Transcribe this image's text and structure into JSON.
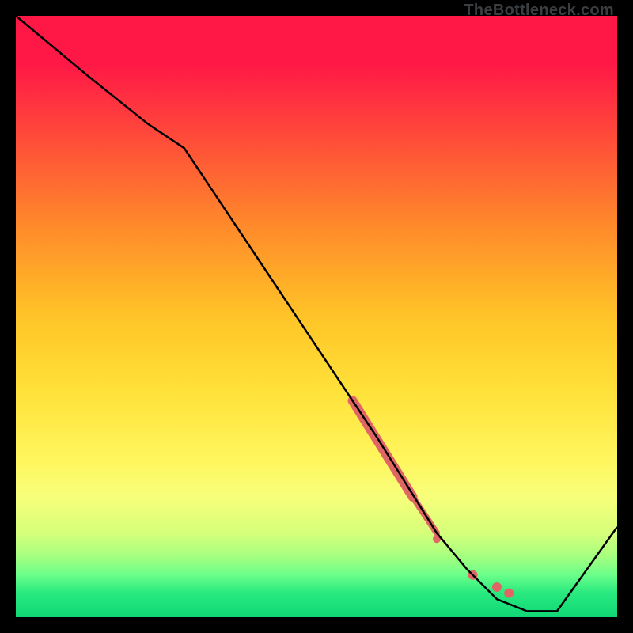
{
  "watermark": "TheBottleneck.com",
  "chart_data": {
    "type": "line",
    "xlim": [
      0,
      100
    ],
    "ylim": [
      0,
      100
    ],
    "title": "",
    "xlabel": "",
    "ylabel": "",
    "x": [
      0,
      12,
      22,
      28,
      40,
      50,
      60,
      65,
      70,
      75,
      80,
      85,
      90,
      100
    ],
    "values": [
      100,
      90,
      82,
      78,
      60,
      45,
      30,
      22,
      14,
      8,
      3,
      1,
      1,
      15
    ],
    "highlight_segments": [
      {
        "x0": 56,
        "y0": 36,
        "x1": 66,
        "y1": 20,
        "width": 12
      },
      {
        "x0": 66,
        "y0": 20,
        "x1": 70,
        "y1": 14,
        "width": 8
      }
    ],
    "highlight_points": [
      {
        "x": 70,
        "y": 13,
        "r": 5
      },
      {
        "x": 76,
        "y": 7,
        "r": 6
      },
      {
        "x": 80,
        "y": 5,
        "r": 6
      },
      {
        "x": 82,
        "y": 4,
        "r": 6
      }
    ],
    "highlight_color": "#e06666",
    "curve_color": "#000000"
  }
}
